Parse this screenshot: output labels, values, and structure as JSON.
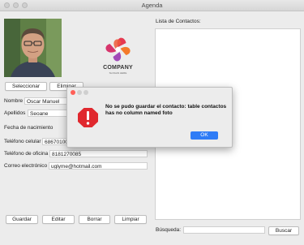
{
  "window": {
    "title": "Agenda"
  },
  "logo": {
    "name": "COMPANY",
    "tagline": "SLOGAN HERE"
  },
  "photo_buttons": {
    "select": "Seleccionar",
    "delete": "Eliminar"
  },
  "form": {
    "nombre": {
      "label": "Nombre",
      "value": "Oscar Manuel"
    },
    "apellidos": {
      "label": "Apellidos",
      "value": "Seoane"
    },
    "fecha": {
      "label": "Fecha de nacimiento",
      "value": ""
    },
    "celular": {
      "label": "Teléfono celular",
      "value": "68670100"
    },
    "oficina": {
      "label": "Teléfono de oficina",
      "value": "8181270085"
    },
    "correo": {
      "label": "Correo electrónico",
      "value": "uglyme@hotmail.com"
    }
  },
  "actions": {
    "save": "Guardar",
    "edit": "Editar",
    "delete": "Borrar",
    "clear": "Limpiar"
  },
  "contacts": {
    "label": "Lista de Contactos:",
    "items": []
  },
  "search": {
    "label": "Búsqueda:",
    "value": "",
    "button": "Buscar"
  },
  "dialog": {
    "message": "No se pudo guardar el contacto: table contactos has no column named foto",
    "ok_label": "OK",
    "accent_color": "#2f7cf6",
    "icon": "error-stop-icon"
  }
}
